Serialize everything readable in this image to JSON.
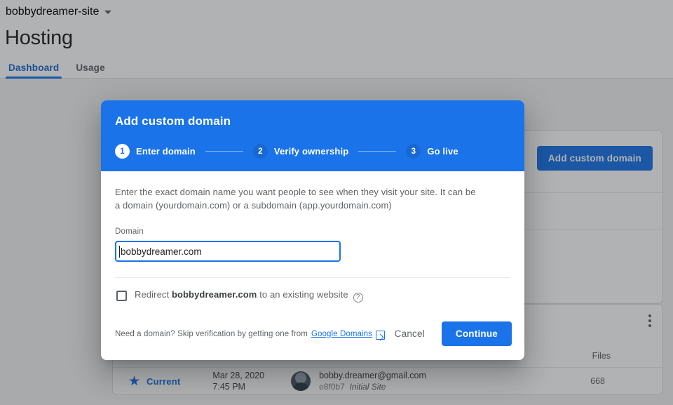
{
  "colors": {
    "brand_blue": "#1a73e8",
    "header_blue": "#1a73e8",
    "step_inactive": "#1967d2",
    "link_blue": "#1a73e8",
    "text_primary": "#202124",
    "text_secondary": "#5f6368"
  },
  "background": {
    "project_selector": "bobbydreamer-site",
    "page_title": "Hosting",
    "tabs": [
      {
        "label": "Dashboard",
        "active": true
      },
      {
        "label": "Usage",
        "active": false
      }
    ],
    "domains_card": {
      "add_custom_domain_button": "Add custom domain"
    },
    "releases_card": {
      "column_files": "Files",
      "row": {
        "status": "Current",
        "date": "Mar 28, 2020",
        "time": "7:45 PM",
        "user_email": "bobby.dreamer@gmail.com",
        "commit": "e8f0b7",
        "description": "Initial Site",
        "files": "668"
      }
    }
  },
  "dialog": {
    "title": "Add custom domain",
    "steps": [
      {
        "number": "1",
        "label": "Enter domain",
        "state": "active"
      },
      {
        "number": "2",
        "label": "Verify ownership",
        "state": "inactive"
      },
      {
        "number": "3",
        "label": "Go live",
        "state": "inactive"
      }
    ],
    "description": "Enter the exact domain name you want people to see when they visit your site. It can be a domain (yourdomain.com) or a subdomain (app.yourdomain.com)",
    "domain_field": {
      "label": "Domain",
      "value": "bobbydreamer.com",
      "placeholder": ""
    },
    "redirect": {
      "checked": false,
      "prefix": "Redirect",
      "domain": "bobbydreamer.com",
      "suffix": "to an existing website",
      "help_icon": "help-circle-icon"
    },
    "footer": {
      "note": "Need a domain? Skip verification by getting one from",
      "link_label": "Google Domains",
      "external_icon": "external-link-icon",
      "cancel_label": "Cancel",
      "continue_label": "Continue"
    }
  }
}
